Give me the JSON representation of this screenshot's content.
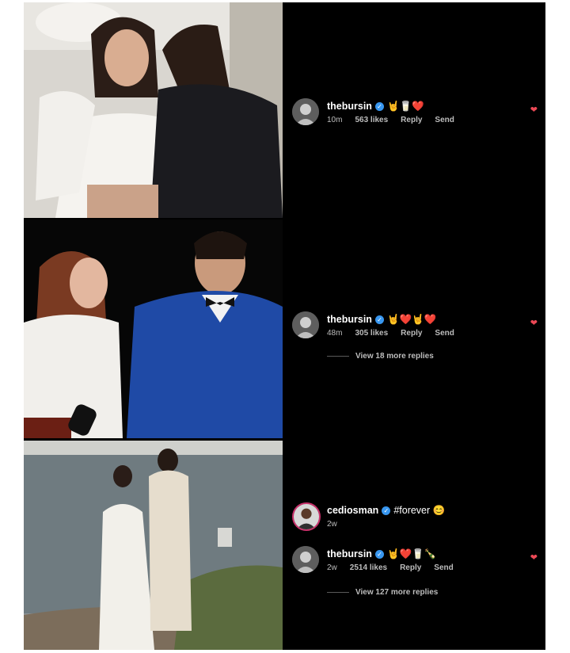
{
  "comments": [
    {
      "username": "thebursin",
      "emoji": "🤘🥛❤️",
      "time": "10m",
      "likes": "563 likes",
      "reply": "Reply",
      "send": "Send"
    },
    {
      "username": "thebursin",
      "emoji": "🤘❤️🤘❤️",
      "time": "48m",
      "likes": "305 likes",
      "reply": "Reply",
      "send": "Send",
      "more_replies": "View 18 more replies"
    },
    {
      "username": "cediosman",
      "emoji": "#forever 😊",
      "time": "2w"
    },
    {
      "username": "thebursin",
      "emoji": "🤘❤️🥛🍾",
      "time": "2w",
      "likes": "2514 likes",
      "reply": "Reply",
      "send": "Send",
      "more_replies": "View 127 more replies"
    }
  ],
  "colors": {
    "background": "#000000",
    "verified": "#3897f0",
    "heart": "#ed4956",
    "meta_text": "#bdbdbd"
  },
  "icons": {
    "heart": "heart-icon",
    "verified": "verified-badge-icon"
  }
}
